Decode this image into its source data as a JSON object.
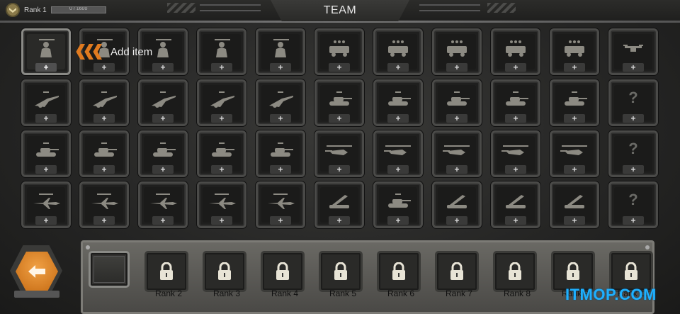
{
  "header": {
    "rank_label": "Rank 1",
    "xp_text": "0 / 1600",
    "xp_progress": 0,
    "title": "TEAM"
  },
  "callout": {
    "add_item_label": "Add item",
    "arrow_color": "#e07a1f"
  },
  "grid": {
    "rows": [
      [
        "infantry-rifle-icon",
        "infantry-machinegun-icon",
        "infantry-sniper-icon",
        "infantry-rocket-icon",
        "infantry-launcher-icon",
        "squad-truck-icon",
        "squad-apc-icon",
        "squad-transport-icon",
        "squad-armored-truck-icon",
        "squad-ifv-icon",
        "drone-icon"
      ],
      [
        "artillery-small-icon",
        "artillery-medium-icon",
        "artillery-heavy-icon",
        "self-propelled-gun-icon",
        "howitzer-icon",
        "armored-car-icon",
        "light-tank-icon",
        "apc-icon",
        "medium-tank-icon",
        "recon-vehicle-icon",
        "locked-unknown-icon"
      ],
      [
        "tank-light-icon",
        "tank-medium-icon",
        "tank-heavy-icon",
        "tank-main-battle-icon",
        "tank-super-heavy-icon",
        "helicopter-light-icon",
        "helicopter-attack-icon",
        "helicopter-gunship-icon",
        "helicopter-transport-icon",
        "helicopter-squad-icon",
        "locked-unknown-icon"
      ],
      [
        "jet-fighter-icon",
        "jet-interceptor-icon",
        "jet-bomber-icon",
        "cargo-plane-icon",
        "transport-plane-icon",
        "sam-launcher-icon",
        "aa-tank-icon",
        "rocket-launcher-icon",
        "ballistic-launcher-icon",
        "heavy-launcher-icon",
        "locked-unknown-icon"
      ]
    ],
    "plus_label": "+",
    "question_label": "?"
  },
  "bottom": {
    "slots": [
      {
        "label": "",
        "locked": false
      },
      {
        "label": "Rank 2",
        "locked": true
      },
      {
        "label": "Rank 3",
        "locked": true
      },
      {
        "label": "Rank 4",
        "locked": true
      },
      {
        "label": "Rank 5",
        "locked": true
      },
      {
        "label": "Rank 6",
        "locked": true
      },
      {
        "label": "Rank 7",
        "locked": true
      },
      {
        "label": "Rank 8",
        "locked": true
      },
      {
        "label": "Rank 9",
        "locked": true
      },
      {
        "label": "Rank 10",
        "locked": true
      }
    ]
  },
  "back_button": {
    "icon": "arrow-left-icon",
    "color": "#e0821c"
  },
  "watermark": "ITMOP.COM"
}
